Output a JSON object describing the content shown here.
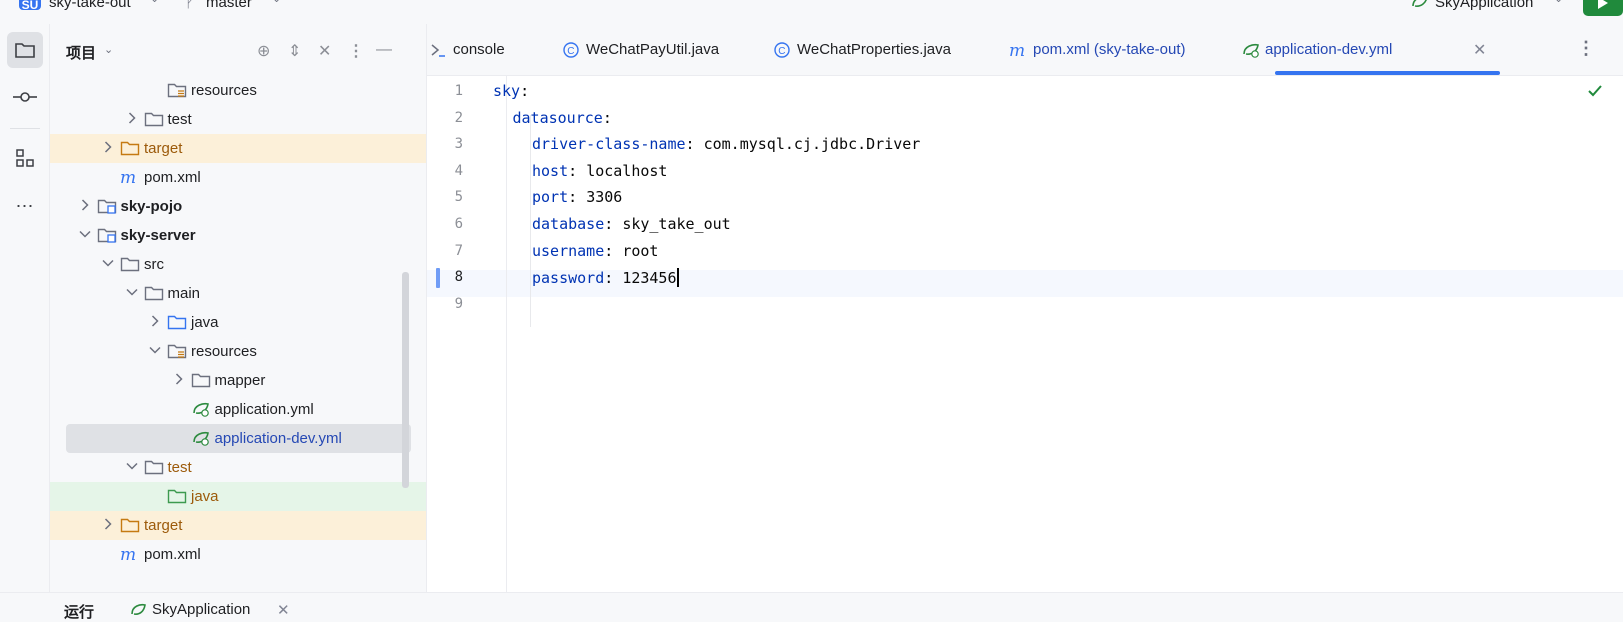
{
  "titlebar": {
    "project_badge": "SU",
    "project_name": "sky-take-out",
    "branch": "master",
    "run_config": "SkyApplication"
  },
  "sidebar": {
    "panel_title": "项目"
  },
  "tree": [
    {
      "label": "resources",
      "type": "folder-resources",
      "depth": 5,
      "expand": "none",
      "style": ""
    },
    {
      "label": "test",
      "type": "folder",
      "depth": 4,
      "expand": "collapsed",
      "style": ""
    },
    {
      "label": "target",
      "type": "folder-orange",
      "depth": 3,
      "expand": "collapsed",
      "style": "orange",
      "highlight": "orange"
    },
    {
      "label": "pom.xml",
      "type": "maven",
      "depth": 3,
      "expand": "none",
      "style": ""
    },
    {
      "label": "sky-pojo",
      "type": "module",
      "depth": 2,
      "expand": "collapsed",
      "style": "bold"
    },
    {
      "label": "sky-server",
      "type": "module",
      "depth": 2,
      "expand": "expanded",
      "style": "bold"
    },
    {
      "label": "src",
      "type": "folder",
      "depth": 3,
      "expand": "expanded",
      "style": ""
    },
    {
      "label": "main",
      "type": "folder",
      "depth": 4,
      "expand": "expanded",
      "style": ""
    },
    {
      "label": "java",
      "type": "folder-blue",
      "depth": 5,
      "expand": "collapsed",
      "style": ""
    },
    {
      "label": "resources",
      "type": "folder-resources",
      "depth": 5,
      "expand": "expanded",
      "style": ""
    },
    {
      "label": "mapper",
      "type": "folder",
      "depth": 6,
      "expand": "collapsed",
      "style": ""
    },
    {
      "label": "application.yml",
      "type": "spring",
      "depth": 6,
      "expand": "none",
      "style": ""
    },
    {
      "label": "application-dev.yml",
      "type": "spring",
      "depth": 6,
      "expand": "none",
      "style": "blue",
      "selected": true
    },
    {
      "label": "test",
      "type": "folder",
      "depth": 4,
      "expand": "expanded",
      "style": "orange-text"
    },
    {
      "label": "java",
      "type": "folder-green",
      "depth": 5,
      "expand": "none",
      "style": "orange-text",
      "highlight": "green"
    },
    {
      "label": "target",
      "type": "folder-orange",
      "depth": 3,
      "expand": "collapsed",
      "style": "orange",
      "highlight": "orange"
    },
    {
      "label": "pom.xml",
      "type": "maven",
      "depth": 3,
      "expand": "none",
      "style": ""
    }
  ],
  "tabs": [
    {
      "label": "console",
      "icon": "console-icon"
    },
    {
      "label": "WeChatPayUtil.java",
      "icon": "class-icon"
    },
    {
      "label": "WeChatProperties.java",
      "icon": "class-icon"
    },
    {
      "label": "pom.xml (sky-take-out)",
      "icon": "maven-icon"
    },
    {
      "label": "application-dev.yml",
      "icon": "spring-icon",
      "active": true
    }
  ],
  "editor": {
    "lines": [
      {
        "n": "1",
        "key": "sky",
        "sep": ":",
        "value": "",
        "indent": 0
      },
      {
        "n": "2",
        "key": "datasource",
        "sep": ":",
        "value": "",
        "indent": 1
      },
      {
        "n": "3",
        "key": "driver-class-name",
        "sep": ": ",
        "value": "com.mysql.cj.jdbc.Driver",
        "indent": 2
      },
      {
        "n": "4",
        "key": "host",
        "sep": ": ",
        "value": "localhost",
        "indent": 2
      },
      {
        "n": "5",
        "key": "port",
        "sep": ": ",
        "value": "3306",
        "indent": 2
      },
      {
        "n": "6",
        "key": "database",
        "sep": ": ",
        "value": "sky_take_out",
        "indent": 2
      },
      {
        "n": "7",
        "key": "username",
        "sep": ": ",
        "value": "root",
        "indent": 2
      },
      {
        "n": "8",
        "key": "password",
        "sep": ": ",
        "value": "123456",
        "indent": 2,
        "current": true
      },
      {
        "n": "9",
        "key": "",
        "sep": "",
        "value": "",
        "indent": 0
      }
    ]
  },
  "bottom": {
    "run_label": "运行",
    "run_tab": "SkyApplication"
  },
  "colors": {
    "accent": "#3574f0",
    "yaml_key": "#0033b3",
    "run_green": "#208a3c"
  }
}
